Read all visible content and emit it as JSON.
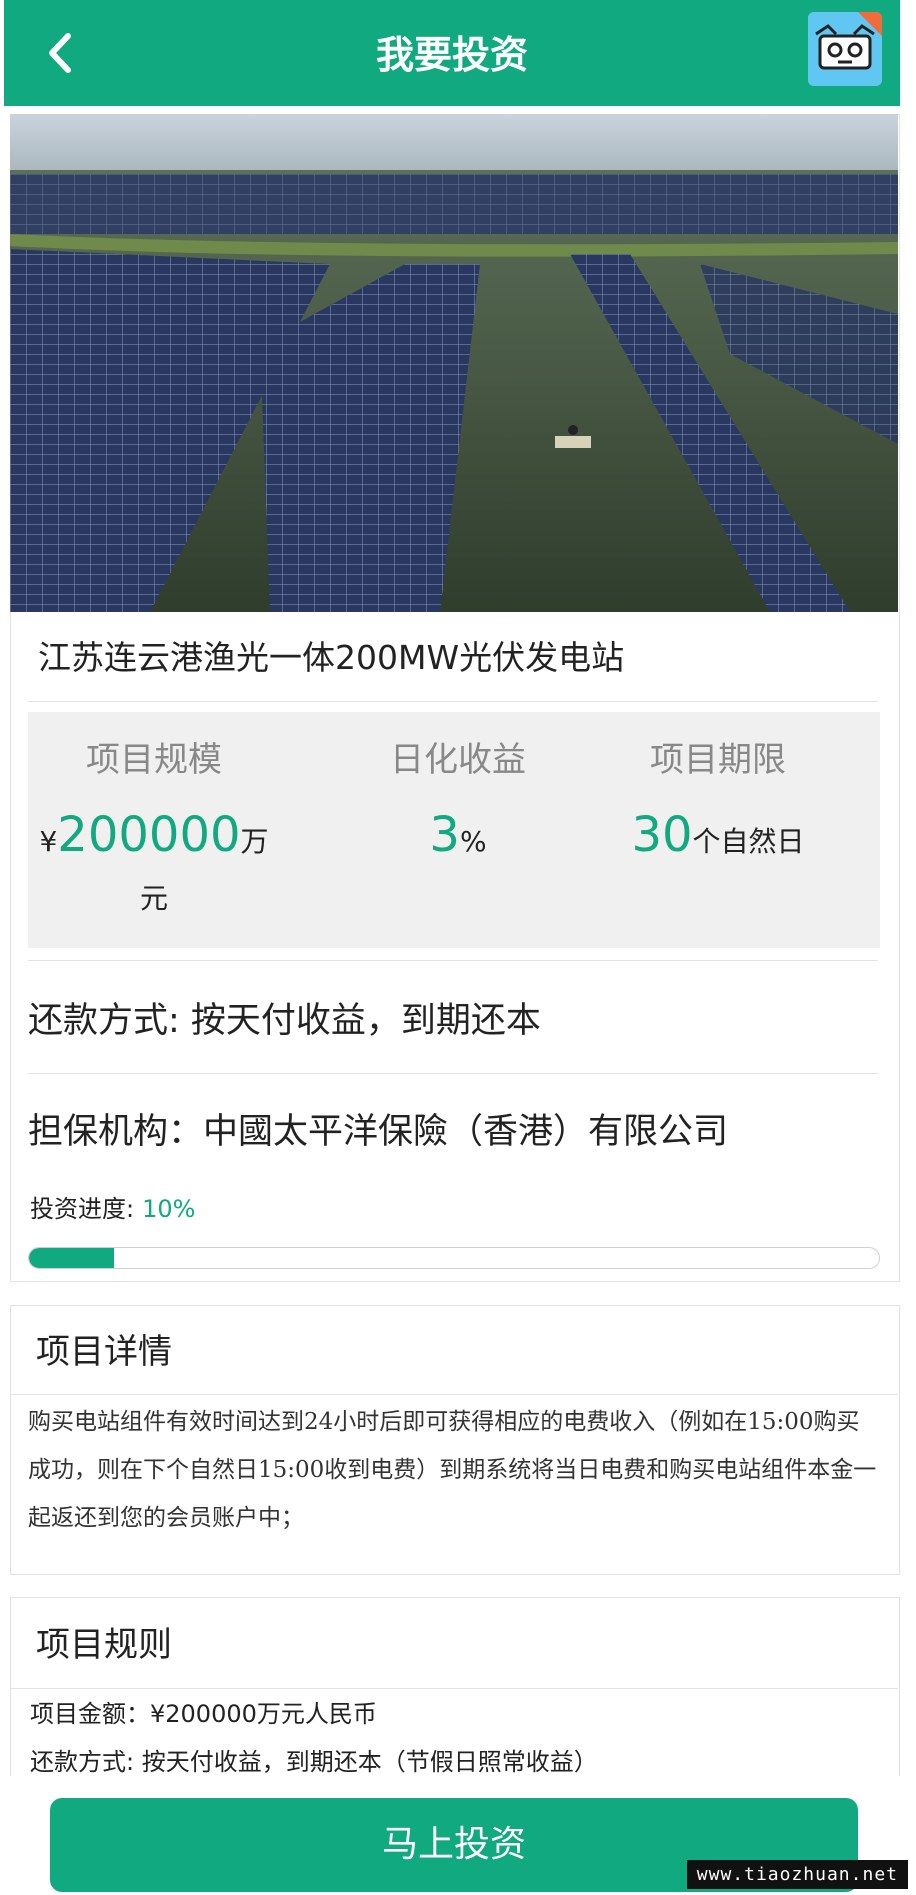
{
  "header": {
    "title": "我要投资",
    "back_icon": "chevron-left-icon",
    "logo_icon": "app-logo-icon"
  },
  "project": {
    "image_alt": "photo",
    "name": "江苏连云港渔光一体200MW光伏发电站",
    "stats": [
      {
        "label": "项目规模",
        "prefix": "¥",
        "value": "200000",
        "unit": "万",
        "unit2": "元"
      },
      {
        "label": "日化收益",
        "value": "3",
        "unit": "%"
      },
      {
        "label": "项目期限",
        "value": "30",
        "unit": "个自然日"
      }
    ],
    "repayment": "还款方式:  按天付收益，到期还本",
    "guarantor": "担保机构：中國太平洋保險（香港）有限公司",
    "progress": {
      "label": "投资进度:",
      "percent_text": "10%",
      "value": 0.1
    }
  },
  "details": {
    "title": "项目详情",
    "text": "购买电站组件有效时间达到24小时后即可获得相应的电费收入（例如在15:00购买成功，则在下个自然日15:00收到电费）到期系统将当日电费和购买电站组件本金一起返还到您的会员账户中；"
  },
  "rules": {
    "title": "项目规则",
    "lines": [
      "项目金额：¥200000万元人民币",
      "还款方式:  按天付收益，到期还本（节假日照常收益）"
    ]
  },
  "cta": {
    "label": "马上投资"
  },
  "watermark": "www.tiaozhuan.net",
  "colors": {
    "primary": "#11a97f"
  }
}
